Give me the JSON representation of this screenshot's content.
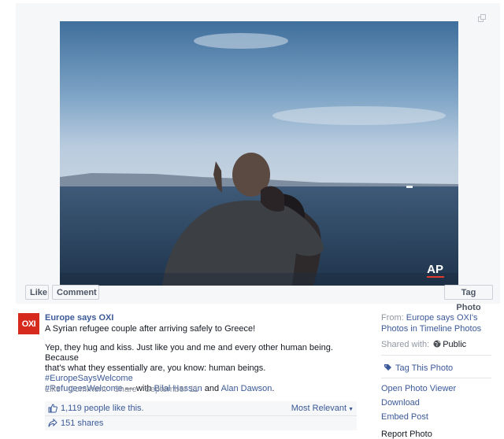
{
  "photo": {
    "watermark": "AP",
    "buttons": {
      "like": "Like",
      "comment": "Comment",
      "tag_photo": "Tag Photo"
    }
  },
  "post": {
    "avatar_text": "OXI",
    "page_name": "Europe says OXI",
    "caption": "A Syrian refugee couple after arriving safely to Greece!",
    "body_line1": "Yep, they hug and kiss. Just like you and me and every other human being. Because",
    "body_line2": "that's what they essentially are, you know: human beings. ",
    "hashtag1": "#EuropeSaysWelcome",
    "hashtag2": "#RefugeesWelcome",
    "with_text": " — with ",
    "tagged1": "Bilal Hassan",
    "and_text": " and ",
    "tagged2": "Alan Dawson",
    "end_text": ".",
    "action_like": "Like",
    "action_comment": "Comment",
    "action_share": "Share",
    "sep": " · ",
    "date": "September 11",
    "likes": "1,119 people like this.",
    "sort": "Most Relevant",
    "shares": "151 shares"
  },
  "sidebar": {
    "from_label": "From: ",
    "from_link1": "Europe says OXI's",
    "from_link2": "Photos in Timeline Photos",
    "shared_with_label": "Shared with: ",
    "shared_with_value": "Public",
    "tag_this": "Tag This Photo",
    "open_viewer": "Open Photo Viewer",
    "download": "Download",
    "embed": "Embed Post",
    "cut_off": "Report Photo"
  },
  "icons": {
    "expand": "expand-icon",
    "thumb": "thumbs-up-icon",
    "share": "share-icon",
    "globe": "globe-icon",
    "tag": "tag-icon",
    "caret": "caret-down-icon"
  },
  "colors": {
    "link": "#3b5998",
    "oxi_red": "#d62a1d",
    "muted": "#9197a3"
  }
}
